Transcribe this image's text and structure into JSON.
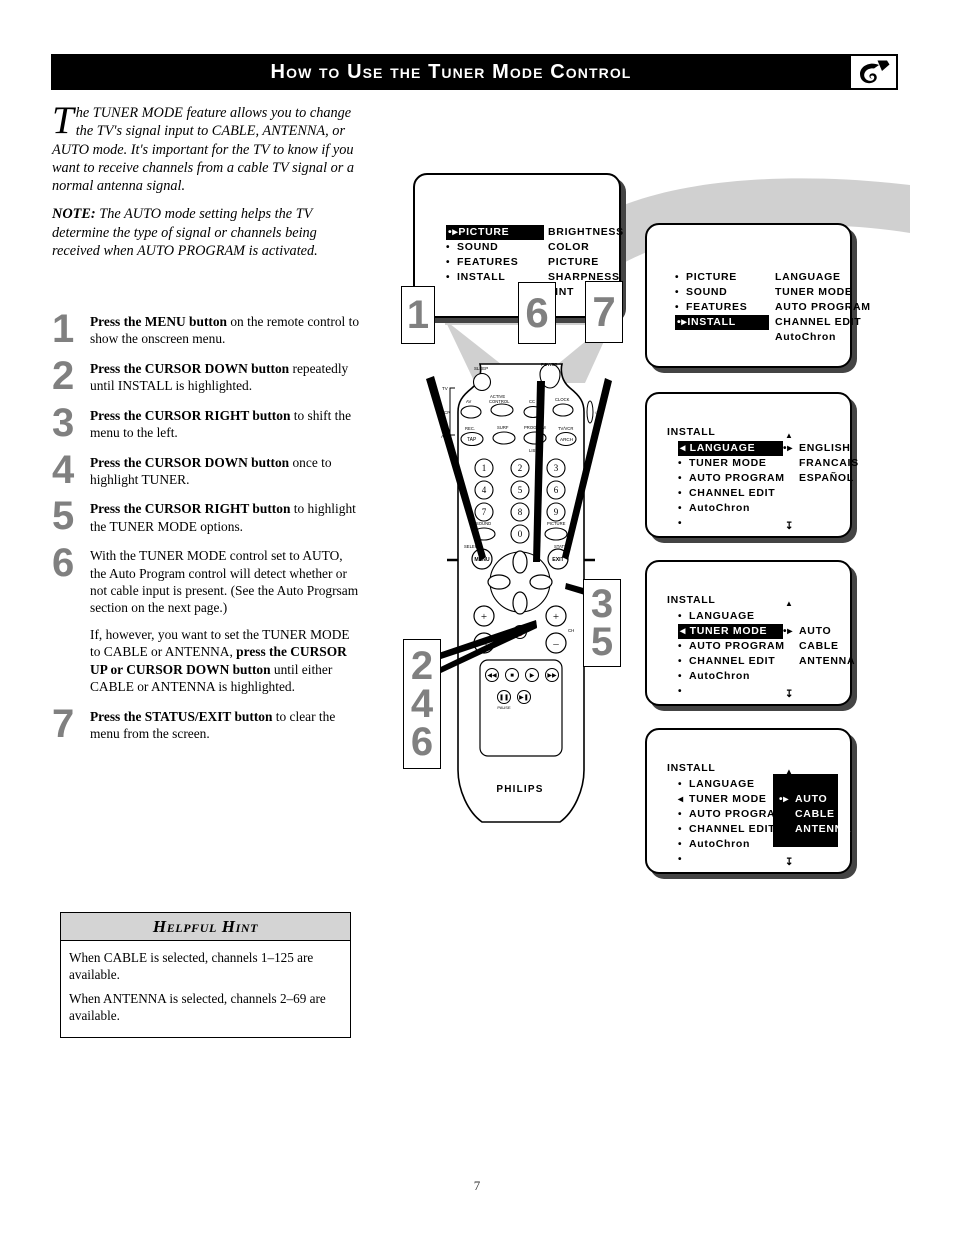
{
  "header": {
    "title": "How to Use the Tuner Mode Control",
    "logo_icon": "remote-control-icon"
  },
  "intro": {
    "dropcap": "T",
    "paragraph": "he TUNER MODE feature allows you to change the TV's signal input to CABLE, ANTENNA, or AUTO mode. It's important for the TV to know if you want to receive channels from a cable TV signal or a normal antenna signal.",
    "note_label": "NOTE:",
    "note_text": " The AUTO mode setting helps the TV determine the type of signal or channels being received when AUTO PROGRAM is activated."
  },
  "steps": [
    {
      "num": "1",
      "bold": "Press the MENU button",
      "rest": " on the remote control to show the onscreen menu."
    },
    {
      "num": "2",
      "bold": "Press the CURSOR DOWN button",
      "rest": " repeatedly until INSTALL is highlighted."
    },
    {
      "num": "3",
      "bold": "Press the CURSOR RIGHT button",
      "rest": " to shift the menu to the left."
    },
    {
      "num": "4",
      "bold": "Press the CURSOR DOWN button",
      "rest": " once to highlight TUNER."
    },
    {
      "num": "5",
      "bold": "Press the CURSOR RIGHT button",
      "rest": " to highlight the TUNER MODE options."
    },
    {
      "num": "6",
      "bold": "",
      "rest": "With the TUNER MODE control set to AUTO, the Auto Program control will detect whether or not cable input is present. (See the Auto Progrsam section on the next page.)",
      "para2_pre": "If, however, you want to set the TUNER MODE to CABLE or ANTENNA, ",
      "para2_bold": "press the CURSOR UP or CURSOR DOWN button",
      "para2_post": " until either CABLE or ANTENNA is highlighted."
    },
    {
      "num": "7",
      "bold": "Press the STATUS/EXIT button",
      "rest": " to clear the menu from the screen."
    }
  ],
  "hint": {
    "title": "Helpful Hint",
    "lines": [
      "When CABLE is selected, channels 1–125 are available.",
      "When ANTENNA is selected, channels 2–69 are available."
    ]
  },
  "screens": {
    "screen1": {
      "left_items": [
        "PICTURE",
        "SOUND",
        "FEATURES",
        "INSTALL"
      ],
      "highlighted": "PICTURE",
      "right_items": [
        "BRIGHTNESS",
        "COLOR",
        "PICTURE",
        "SHARPNESS",
        "TINT"
      ]
    },
    "screen2": {
      "left_items": [
        "PICTURE",
        "SOUND",
        "FEATURES",
        "INSTALL"
      ],
      "highlighted": "INSTALL",
      "right_items": [
        "LANGUAGE",
        "TUNER MODE",
        "AUTO PROGRAM",
        "CHANNEL EDIT",
        "AutoChron"
      ]
    },
    "screen3": {
      "title": "INSTALL",
      "left_items": [
        "LANGUAGE",
        "TUNER MODE",
        "AUTO PROGRAM",
        "CHANNEL EDIT",
        "AutoChron",
        ""
      ],
      "highlighted": "LANGUAGE",
      "right_items": [
        "ENGLISH",
        "FRANCAIS",
        "ESPAÑOL"
      ],
      "selected_right": "ENGLISH",
      "up_arrow": "▲",
      "down_arrow": "↧"
    },
    "screen4": {
      "title": "INSTALL",
      "left_items": [
        "LANGUAGE",
        "TUNER MODE",
        "AUTO PROGRAM",
        "CHANNEL EDIT",
        "AutoChron",
        ""
      ],
      "highlighted": "TUNER MODE",
      "right_items": [
        "AUTO",
        "CABLE",
        "ANTENNA"
      ],
      "selected_right": "AUTO",
      "up_arrow": "▲",
      "down_arrow": "↧"
    },
    "screen5": {
      "title": "INSTALL",
      "left_items": [
        "LANGUAGE",
        "TUNER MODE",
        "AUTO PROGRAM",
        "CHANNEL EDIT",
        "AutoChron",
        ""
      ],
      "highlighted": "",
      "right_items": [
        "AUTO",
        "CABLE",
        "ANTENNA"
      ],
      "right_panel_highlighted": true,
      "selected_right": "AUTO",
      "up_arrow": "▲",
      "down_arrow": "↧"
    }
  },
  "remote": {
    "brand": "PHILIPS",
    "labels": {
      "sleep": "SLEEP",
      "power": "POWER",
      "av": "AV",
      "active_control": "ACTIVE CONTROL",
      "cc": "CC",
      "clock": "CLOCK",
      "rec_tap": "REC. TAP",
      "surf": "SURF",
      "program": "PROGRAM",
      "list": "LIST",
      "tvvcr": "TV/VCR",
      "arch": "ARCH",
      "tv": "TV",
      "vcr": "VCR",
      "acc": "ACC",
      "sound": "SOUND",
      "picture": "PICTURE",
      "select": "SELECT",
      "menu": "MENU",
      "exit": "EXIT",
      "status": "STATUS",
      "ch": "CH",
      "pause": "PAUSE"
    },
    "keypad": [
      "1",
      "2",
      "3",
      "4",
      "5",
      "6",
      "7",
      "8",
      "9",
      "0"
    ]
  },
  "callouts": {
    "c1": [
      "1"
    ],
    "c6": [
      "6"
    ],
    "c7": [
      "7"
    ],
    "c35": [
      "3",
      "5"
    ],
    "c246": [
      "2",
      "4",
      "6"
    ]
  },
  "page_number": "7",
  "colors": {
    "header_bg": "#000000",
    "step_number": "#808080",
    "hint_header_bg": "#d4d4d4",
    "beam_gray": "#d0d0d0"
  }
}
